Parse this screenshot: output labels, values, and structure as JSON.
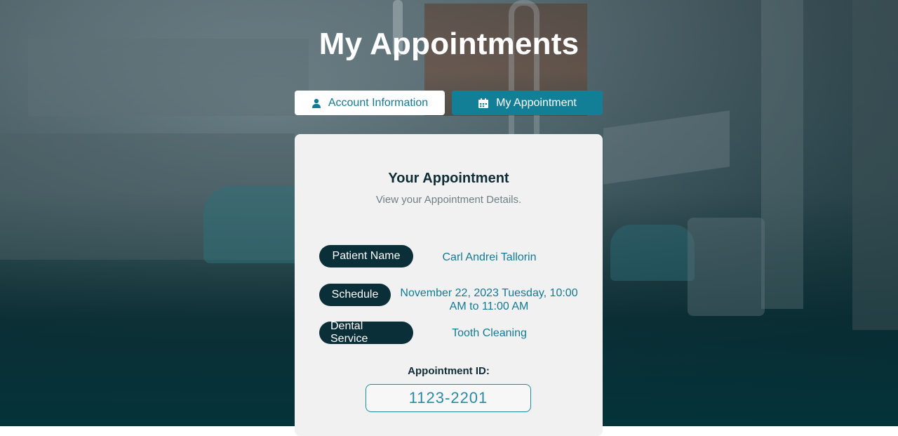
{
  "page": {
    "title": "My Appointments"
  },
  "tabs": [
    {
      "label": "Account Information",
      "icon": "user-icon",
      "active": false
    },
    {
      "label": "My Appointment",
      "icon": "calendar-icon",
      "active": true
    }
  ],
  "card": {
    "title": "Your Appointment",
    "subtitle": "View your Appointment Details.",
    "fields": {
      "patient_name": {
        "label": "Patient Name",
        "value": "Carl Andrei Tallorin"
      },
      "schedule": {
        "label": "Schedule",
        "value": "November 22, 2023 Tuesday, 10:00 AM to 11:00 AM"
      },
      "dental_service": {
        "label": "Dental Service",
        "value": "Tooth Cleaning"
      }
    },
    "appointment_id_label": "Appointment ID:",
    "appointment_id": "1123-2201"
  },
  "colors": {
    "accent": "#137f97",
    "dark_pill": "#0b2f38",
    "card_bg": "#f1f1f1",
    "value_text": "#137a93"
  }
}
